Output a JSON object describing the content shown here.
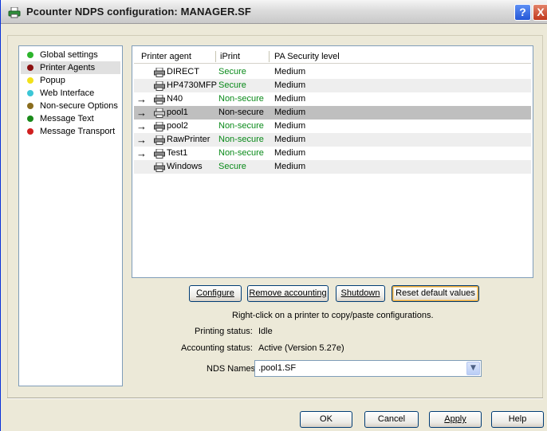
{
  "window": {
    "title": "Pcounter NDPS configuration: MANAGER.SF"
  },
  "titlebar": {
    "help_glyph": "?",
    "close_glyph": "X"
  },
  "nav": {
    "items": [
      {
        "label": "Global settings",
        "color": "#2db52d"
      },
      {
        "label": "Printer Agents",
        "color": "#8b1010",
        "selected": true
      },
      {
        "label": "Popup",
        "color": "#f2e11a"
      },
      {
        "label": "Web Interface",
        "color": "#3cc6d6"
      },
      {
        "label": "Non-secure Options",
        "color": "#8a6d1e"
      },
      {
        "label": "Message Text",
        "color": "#1a8a1a"
      },
      {
        "label": "Message Transport",
        "color": "#d02020"
      }
    ]
  },
  "table": {
    "headers": {
      "agent": "Printer agent",
      "iprint": "iPrint",
      "security": "PA Security level"
    },
    "rows": [
      {
        "arrow": "",
        "name": "DIRECT",
        "iprint": "Secure",
        "security": "Medium"
      },
      {
        "arrow": "",
        "name": "HP4730MFP",
        "iprint": "Secure",
        "security": "Medium"
      },
      {
        "arrow": "→",
        "name": "N40",
        "iprint": "Non-secure",
        "security": "Medium"
      },
      {
        "arrow": "→",
        "name": "pool1",
        "iprint": "Non-secure",
        "security": "Medium"
      },
      {
        "arrow": "→",
        "name": "pool2",
        "iprint": "Non-secure",
        "security": "Medium"
      },
      {
        "arrow": "→",
        "name": "RawPrinter",
        "iprint": "Non-secure",
        "security": "Medium"
      },
      {
        "arrow": "→",
        "name": "Test1",
        "iprint": "Non-secure",
        "security": "Medium"
      },
      {
        "arrow": "",
        "name": "Windows",
        "iprint": "Secure",
        "security": "Medium"
      }
    ]
  },
  "actions": {
    "configure": "Configure",
    "remove_accounting": "Remove accounting",
    "shutdown": "Shutdown",
    "reset_defaults": "Reset default values"
  },
  "info": {
    "hint": "Right-click on a printer to copy/paste configurations.",
    "printing_label": "Printing status:",
    "printing_value": "Idle",
    "accounting_label": "Accounting status:",
    "accounting_value": "Active (Version 5.27e)",
    "nds_label": "NDS Names:",
    "nds_value": ".pool1.SF"
  },
  "footer": {
    "ok": "OK",
    "cancel": "Cancel",
    "apply": "Apply",
    "help": "Help"
  },
  "icons": {
    "dropdown": "chevron-down-icon",
    "printer": "printer-icon",
    "arrow": "arrow-right-icon"
  }
}
